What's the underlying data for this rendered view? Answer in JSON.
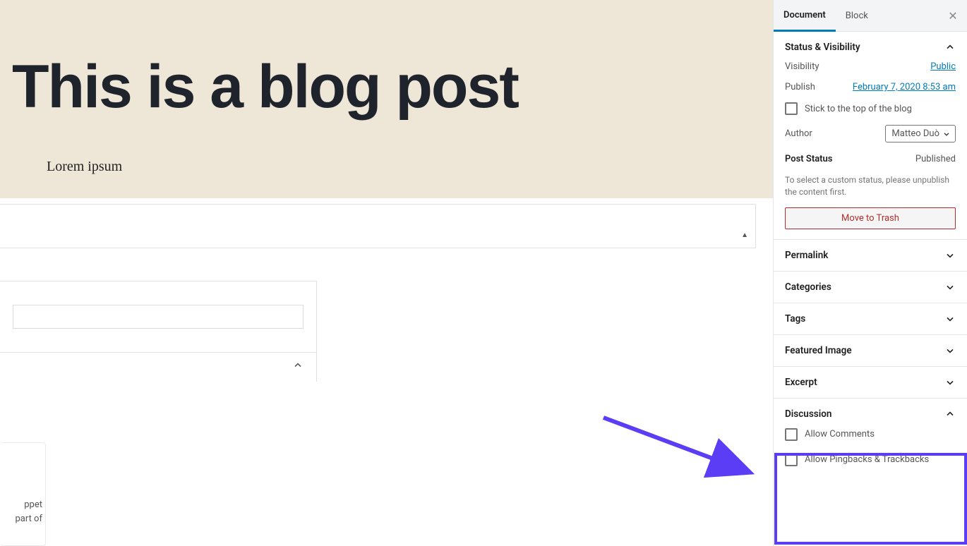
{
  "post": {
    "title": "This is a blog post",
    "body": "Lorem ipsum"
  },
  "snippet": {
    "line1": "ppet",
    "line2": "part of"
  },
  "tabs": {
    "document": "Document",
    "block": "Block"
  },
  "status_panel": {
    "title": "Status & Visibility",
    "visibility_label": "Visibility",
    "visibility_value": "Public",
    "publish_label": "Publish",
    "publish_value": "February 7, 2020 8:53 am",
    "sticky_label": "Stick to the top of the blog",
    "author_label": "Author",
    "author_value": "Matteo Duò",
    "post_status_label": "Post Status",
    "post_status_value": "Published",
    "note": "To select a custom status, please unpublish the content first.",
    "trash": "Move to Trash"
  },
  "panels": {
    "permalink": "Permalink",
    "categories": "Categories",
    "tags": "Tags",
    "featured": "Featured Image",
    "excerpt": "Excerpt",
    "discussion": "Discussion"
  },
  "discussion": {
    "allow_comments": "Allow Comments",
    "allow_pingbacks": "Allow Pingbacks & Trackbacks"
  }
}
